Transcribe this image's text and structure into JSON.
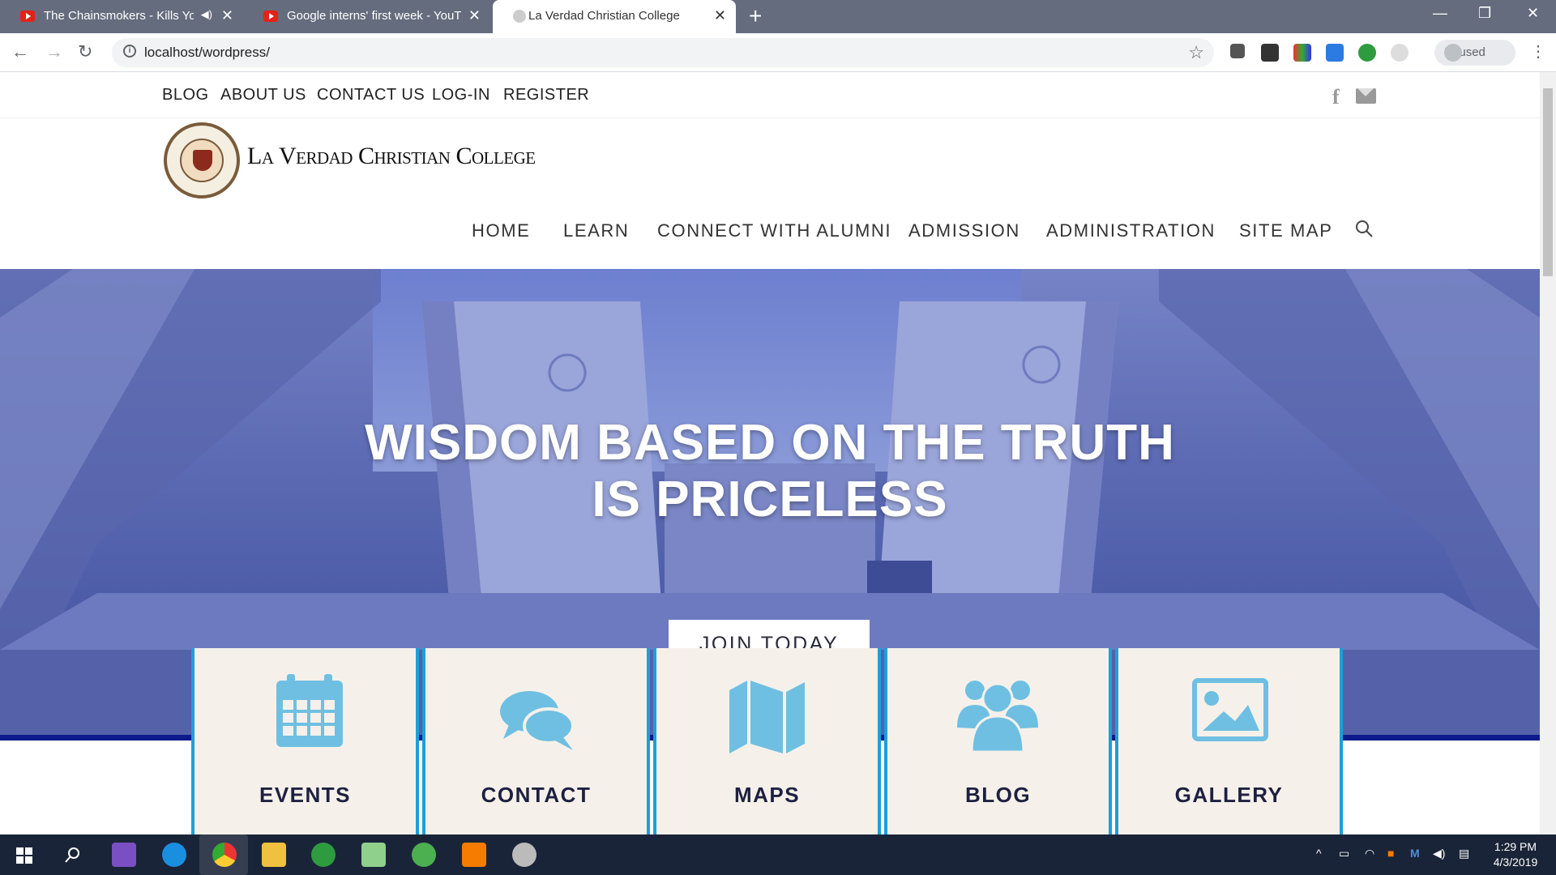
{
  "browser": {
    "tabs": [
      {
        "title": "The Chainsmokers - Kills You",
        "audio": "speaker-icon"
      },
      {
        "title": "Google interns' first week - YouTube"
      },
      {
        "title": "La Verdad Christian College"
      }
    ],
    "url": "localhost/wordpress/",
    "profile_status": "Paused"
  },
  "site": {
    "top_links": [
      "BLOG",
      "ABOUT US",
      "CONTACT US",
      "LOG-IN",
      "REGISTER"
    ],
    "brand": "La Verdad Christian College",
    "main_nav": [
      "HOME",
      "LEARN",
      "CONNECT WITH ALUMNI",
      "ADMISSION",
      "ADMINISTRATION",
      "SITE MAP"
    ],
    "hero": {
      "line1": "WISDOM BASED ON THE TRUTH",
      "line2": "IS PRICELESS",
      "cta": "JOIN TODAY"
    },
    "features": [
      {
        "label": "EVENTS",
        "icon": "calendar-icon"
      },
      {
        "label": "CONTACT",
        "icon": "chat-icon"
      },
      {
        "label": "MAPS",
        "icon": "map-icon"
      },
      {
        "label": "BLOG",
        "icon": "users-icon"
      },
      {
        "label": "GALLERY",
        "icon": "image-icon"
      }
    ],
    "accent_color": "#1e9fd8",
    "icon_color": "#6fbfe2"
  },
  "taskbar": {
    "time": "1:29 PM",
    "date": "4/3/2019"
  }
}
